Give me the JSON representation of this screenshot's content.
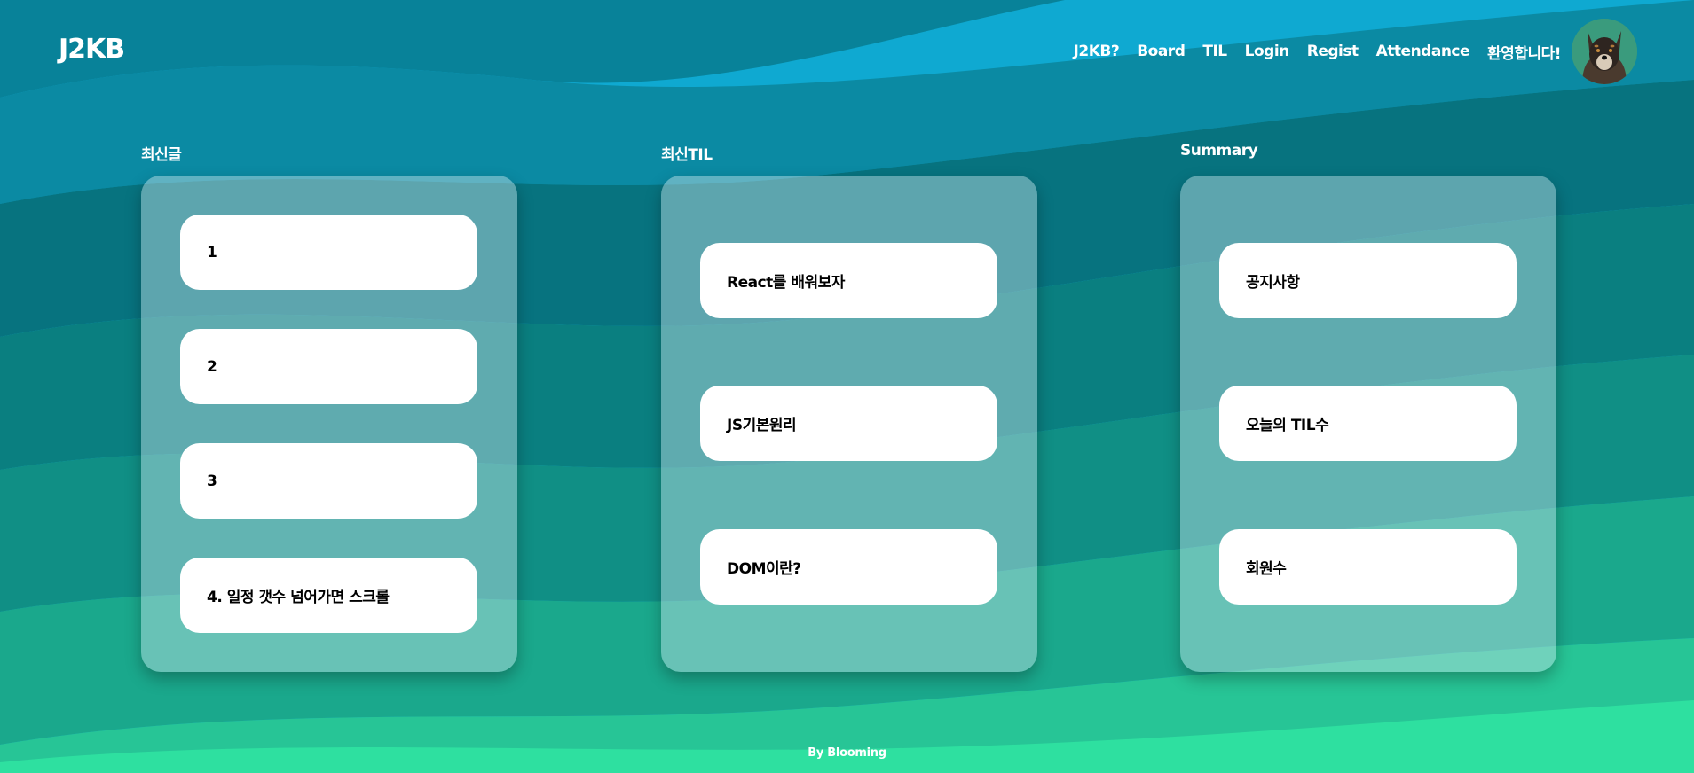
{
  "header": {
    "logo": "J2KB",
    "nav": [
      "J2KB?",
      "Board",
      "TIL",
      "Login",
      "Regist",
      "Attendance",
      "환영합니다!"
    ]
  },
  "sections": {
    "latest_posts": {
      "title": "최신글",
      "items": [
        "1",
        "2",
        "3",
        "4. 일정 갯수 넘어가면 스크롤"
      ]
    },
    "latest_til": {
      "title": "최신TIL",
      "items": [
        "React를 배워보자",
        "JS기본원리",
        "DOM이란?"
      ]
    },
    "summary": {
      "title": "Summary",
      "items": [
        "공지사항",
        "오늘의 TIL수",
        "회원수"
      ]
    }
  },
  "footer": {
    "text": "By Blooming"
  },
  "theme": {
    "gradient_top": "#0fa9d1",
    "gradient_mid": "#086e73",
    "gradient_bottom": "#2ee0a0",
    "card": "#ffffff"
  }
}
